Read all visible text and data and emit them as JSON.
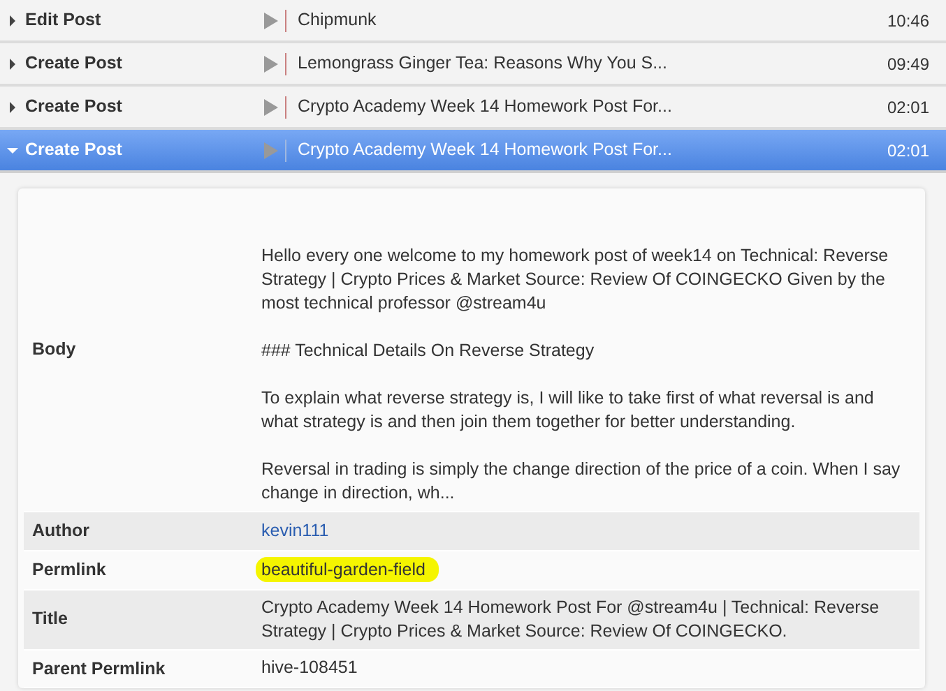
{
  "events": [
    {
      "action": "Edit Post",
      "title": "Chipmunk",
      "time": "10:46",
      "expanded": false
    },
    {
      "action": "Create Post",
      "title": "Lemongrass Ginger Tea: Reasons Why You S...",
      "time": "09:49",
      "expanded": false
    },
    {
      "action": "Create Post",
      "title": "Crypto Academy Week 14 Homework Post For...",
      "time": "02:01",
      "expanded": false
    },
    {
      "action": "Create Post",
      "title": "Crypto Academy Week 14 Homework Post For...",
      "time": "02:01",
      "expanded": true
    }
  ],
  "details": [
    {
      "label": "Body",
      "kind": "text",
      "highlighted": false,
      "value": "Hello every one welcome to my homework post of week14 on Technical: Reverse Strategy | Crypto Prices & Market Source: Review Of COINGECKO Given by the most technical professor @stream4u\n\n### Technical Details On Reverse Strategy\n\nTo explain what reverse strategy is, I will like to take first of what reversal is and what strategy is and then join them together for better understanding.\n\nReversal in trading is simply the change direction of the price of a coin. When I say change in direction, wh..."
    },
    {
      "label": "Author",
      "kind": "link",
      "highlighted": false,
      "value": "kevin111"
    },
    {
      "label": "Permlink",
      "kind": "text",
      "highlighted": true,
      "value": "beautiful-garden-field"
    },
    {
      "label": "Title",
      "kind": "text",
      "highlighted": false,
      "value": "Crypto Academy Week 14 Homework Post For @stream4u | Technical: Reverse Strategy | Crypto Prices & Market Source: Review Of COINGECKO."
    },
    {
      "label": "Parent Permlink",
      "kind": "text",
      "highlighted": false,
      "value": "hive-108451"
    }
  ]
}
